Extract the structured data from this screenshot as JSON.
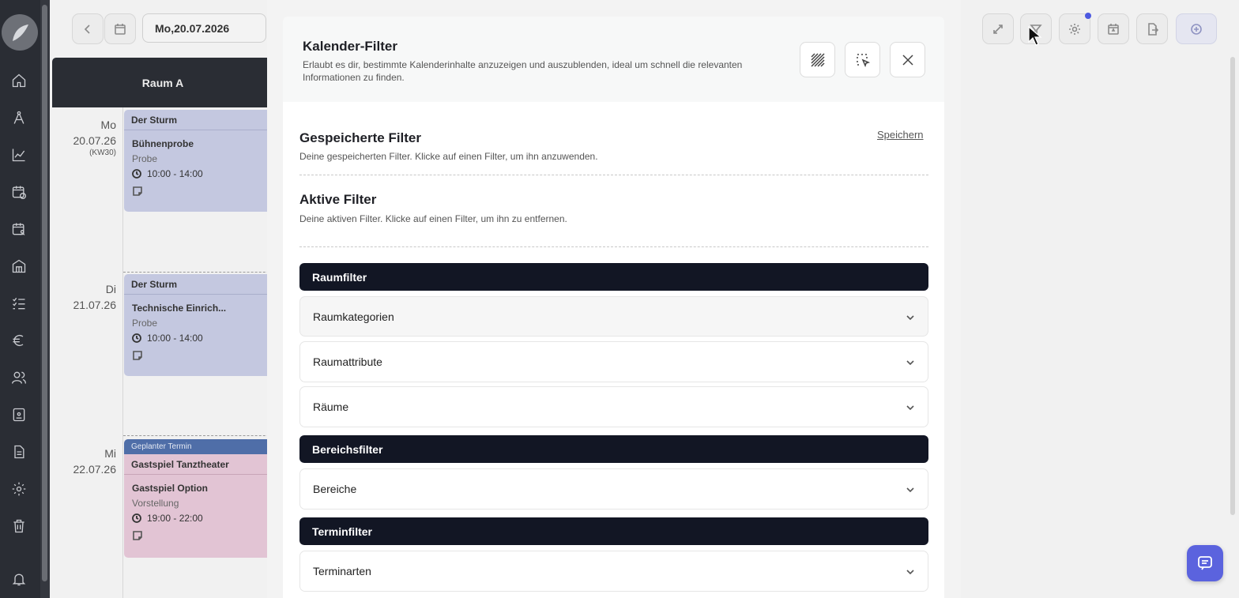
{
  "calendar": {
    "date": "Mo,20.07.2026",
    "room": "Raum A",
    "days": [
      {
        "weekday": "Mo",
        "date": "20.07.26",
        "kw": "(KW30)"
      },
      {
        "weekday": "Di",
        "date": "21.07.26",
        "kw": ""
      },
      {
        "weekday": "Mi",
        "date": "22.07.26",
        "kw": ""
      }
    ],
    "events": [
      {
        "group": "Der Sturm",
        "planned": "",
        "title": "Bühnenprobe",
        "type": "Probe",
        "time": "10:00 - 14:00"
      },
      {
        "group": "Der Sturm",
        "planned": "",
        "title": "Technische Einrich...",
        "type": "Probe",
        "time": "10:00 - 14:00"
      },
      {
        "group": "Gastspiel Tanztheater",
        "planned": "Geplanter Termin",
        "title": "Gastspiel Option",
        "type": "Vorstellung",
        "time": "19:00 - 22:00"
      }
    ]
  },
  "modal": {
    "title": "Kalender-Filter",
    "description": "Erlaubt es dir, bestimmte Kalenderinhalte anzuzeigen und auszublenden, ideal um schnell die relevanten Informationen zu finden.",
    "saved": {
      "title": "Gespeicherte Filter",
      "description": "Deine gespeicherten Filter. Klicke auf einen Filter, um ihn anzuwenden.",
      "save_link": "Speichern"
    },
    "active": {
      "title": "Aktive Filter",
      "description": "Deine aktiven Filter. Klicke auf einen Filter, um ihn zu entfernen."
    },
    "groups": [
      {
        "label": "Raumfilter",
        "items": [
          "Raumkategorien",
          "Raumattribute",
          "Räume"
        ]
      },
      {
        "label": "Bereichsfilter",
        "items": [
          "Bereiche"
        ]
      },
      {
        "label": "Terminfilter",
        "items": [
          "Terminarten"
        ]
      }
    ]
  },
  "colors": {
    "sidebar": "#2a2d34",
    "group_bar": "#121624",
    "event_blue": "#c4c8e0",
    "event_pink": "#e2c4d4",
    "planned_badge": "#4f6ea8",
    "chat_button": "#5b63de",
    "notification_dot": "#4c59e0"
  }
}
